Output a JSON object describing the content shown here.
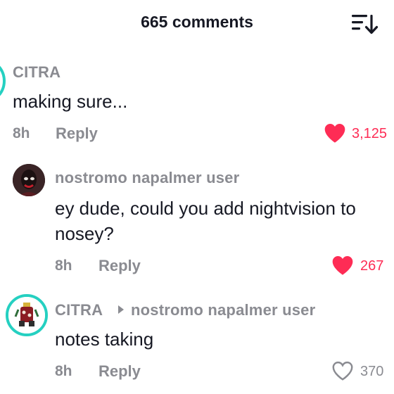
{
  "header": {
    "title": "665 comments",
    "sort_icon": "sort-descending-icon"
  },
  "comments": [
    {
      "username": "CITRA",
      "text": "making sure...",
      "time": "8h",
      "reply_label": "Reply",
      "like_count": "3,125",
      "liked": true
    },
    {
      "username": "nostromo napalmer user",
      "text_line1": "ey dude, could you add nightvision to",
      "text_line2": "nosey?",
      "time": "8h",
      "reply_label": "Reply",
      "like_count": "267",
      "liked": true
    },
    {
      "username": "CITRA",
      "reply_to": "nostromo napalmer user",
      "text": "notes taking",
      "time": "8h",
      "reply_label": "Reply",
      "like_count": "370",
      "liked": false
    }
  ],
  "colors": {
    "accent_red": "#fe2c55",
    "muted_gray": "#8a8b91",
    "text_dark": "#161823",
    "avatar_ring_teal": "#25d0c1"
  }
}
